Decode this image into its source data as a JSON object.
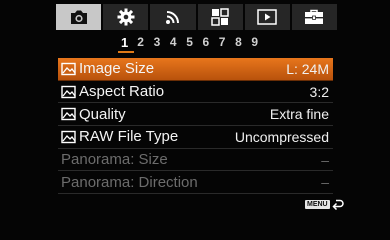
{
  "tabs": [
    {
      "icon": "camera-icon",
      "active": true
    },
    {
      "icon": "gear-icon",
      "active": false
    },
    {
      "icon": "wireless-icon",
      "active": false
    },
    {
      "icon": "custom-grid-icon",
      "active": false
    },
    {
      "icon": "play-icon",
      "active": false
    },
    {
      "icon": "toolbox-icon",
      "active": false
    }
  ],
  "pages": [
    "1",
    "2",
    "3",
    "4",
    "5",
    "6",
    "7",
    "8",
    "9"
  ],
  "active_page": "1",
  "menu": {
    "items": [
      {
        "label": "Image Size",
        "value": "L: 24M",
        "icon": "image-icon",
        "selected": true,
        "disabled": false
      },
      {
        "label": "Aspect Ratio",
        "value": "3:2",
        "icon": "image-icon",
        "selected": false,
        "disabled": false
      },
      {
        "label": "Quality",
        "value": "Extra fine",
        "icon": "image-icon",
        "selected": false,
        "disabled": false
      },
      {
        "label": "RAW File Type",
        "value": "Uncompressed",
        "icon": "image-icon",
        "selected": false,
        "disabled": false
      },
      {
        "label": "Panorama: Size",
        "value": "–",
        "icon": "",
        "selected": false,
        "disabled": true
      },
      {
        "label": "Panorama: Direction",
        "value": "–",
        "icon": "",
        "selected": false,
        "disabled": true
      }
    ]
  },
  "footer": {
    "menu_label": "MENU",
    "back_icon": "return-arrow-icon"
  },
  "colors": {
    "accent": "#e07a18",
    "background": "#050505",
    "tab_active": "#c8c8c8",
    "disabled_text": "#6c6c6c"
  }
}
